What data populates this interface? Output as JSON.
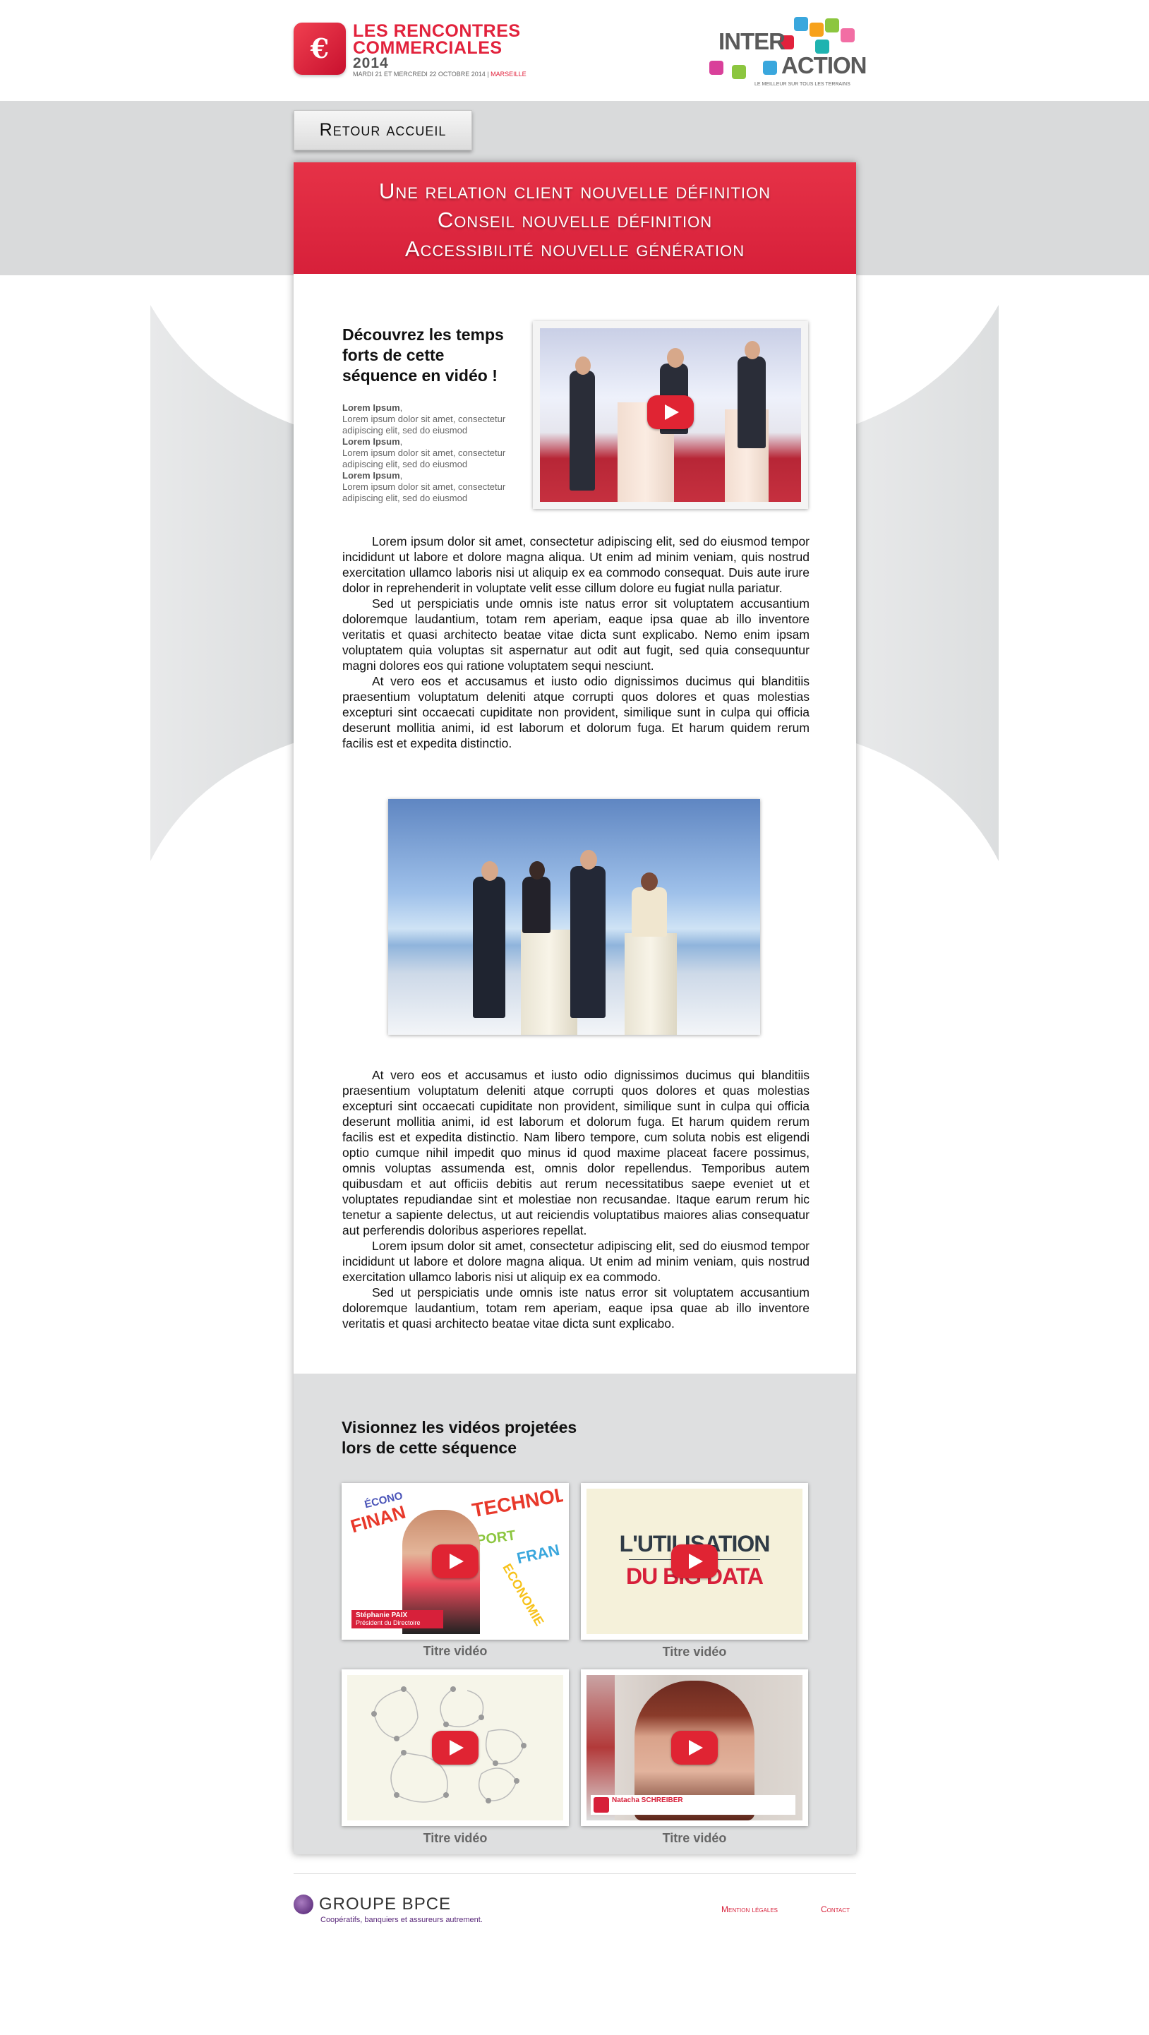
{
  "header": {
    "event_title_line1": "LES RENCONTRES",
    "event_title_line2": "COMMERCIALES",
    "event_year": "2014",
    "event_dates": "MARDI 21 ET MERCREDI 22 OCTOBRE 2014",
    "event_city": "MARSEILLE",
    "partner_word1": "INTER",
    "partner_word2": "ACTION",
    "partner_tagline": "LE MEILLEUR SUR TOUS LES TERRAINS"
  },
  "back_button": {
    "label": "Retour accueil"
  },
  "banner": {
    "line1": "Une relation client nouvelle définition",
    "line2": "Conseil nouvelle définition",
    "line3": "Accessibilité nouvelle génération"
  },
  "intro": {
    "title": "Découvrez les temps forts de cette séquence en vidéo !",
    "items": [
      {
        "head": "Lorem Ipsum",
        "text": "Lorem ipsum dolor sit amet, consectetur adipiscing elit, sed do eiusmod"
      },
      {
        "head": "Lorem Ipsum",
        "text": "Lorem ipsum dolor sit amet, consectetur adipiscing elit, sed do eiusmod"
      },
      {
        "head": "Lorem Ipsum",
        "text": "Lorem ipsum dolor sit amet, consectetur adipiscing elit, sed do eiusmod"
      }
    ]
  },
  "body_top": [
    "Lorem ipsum dolor sit amet, consectetur adipiscing elit, sed do eiusmod tempor incididunt ut labore et dolore magna aliqua. Ut enim ad minim veniam, quis nostrud exercitation ullamco laboris nisi ut aliquip ex ea commodo consequat. Duis aute irure dolor in reprehenderit in voluptate velit esse cillum dolore eu fugiat nulla pariatur.",
    "Sed ut perspiciatis unde omnis iste natus error sit voluptatem accusantium doloremque laudantium, totam rem aperiam, eaque ipsa quae ab illo inventore veritatis et quasi architecto beatae vitae dicta sunt explicabo. Nemo enim ipsam voluptatem quia voluptas sit aspernatur aut odit aut fugit, sed quia consequuntur magni dolores eos qui ratione voluptatem sequi nesciunt.",
    "At vero eos et accusamus et iusto odio dignissimos ducimus qui blanditiis praesentium voluptatum deleniti atque corrupti quos dolores et quas molestias excepturi sint occaecati cupiditate non provident, similique sunt in culpa qui officia deserunt mollitia animi, id est laborum et dolorum fuga. Et harum quidem rerum facilis est et expedita distinctio."
  ],
  "body_bottom": [
    "At vero eos et accusamus et iusto odio dignissimos ducimus qui blanditiis praesentium voluptatum deleniti atque corrupti quos dolores et quas molestias excepturi sint occaecati cupiditate non provident, similique sunt in culpa qui officia deserunt mollitia animi, id est laborum et dolorum fuga. Et harum quidem rerum facilis est et expedita distinctio. Nam libero tempore, cum soluta nobis est eligendi optio cumque nihil impedit quo minus id quod maxime placeat facere possimus, omnis voluptas assumenda est, omnis dolor repellendus. Temporibus autem quibusdam et aut officiis debitis aut rerum necessitatibus saepe eveniet ut et voluptates repudiandae sint et molestiae non recusandae. Itaque earum rerum hic tenetur a sapiente delectus, ut aut reiciendis voluptatibus maiores alias consequatur aut perferendis doloribus asperiores repellat.",
    "Lorem ipsum dolor sit amet, consectetur adipiscing elit, sed do eiusmod tempor incididunt ut labore et dolore magna aliqua. Ut enim ad minim veniam, quis nostrud exercitation ullamco laboris nisi ut aliquip ex ea commodo.",
    "Sed ut perspiciatis unde omnis iste natus error sit voluptatem accusantium doloremque laudantium, totam rem aperiam, eaque ipsa quae ab illo inventore veritatis et quasi architecto beatae vitae dicta sunt explicabo."
  ],
  "videos_section": {
    "title_line1": "Visionnez les vidéos projetées",
    "title_line2": "lors de cette séquence",
    "videos": [
      {
        "caption": "Titre vidéo",
        "person_name": "Stéphanie PAIX",
        "person_role": "Président du Directoire",
        "words": [
          "TECHNOLO",
          "FINAN",
          "ECONOMIE",
          "SPORT",
          "FRAN",
          "ÉCONO"
        ]
      },
      {
        "caption": "Titre vidéo",
        "slide_line1": "L'UTILISATION",
        "slide_line2": "DU BIG DATA"
      },
      {
        "caption": "Titre vidéo"
      },
      {
        "caption": "Titre vidéo",
        "person_name": "Natacha SCHREIBER"
      }
    ]
  },
  "footer": {
    "group_name": "GROUPE BPCE",
    "slogan": "Coopératifs, banquiers et assureurs autrement.",
    "legal_link": "Mention légales",
    "contact_link": "Contact"
  },
  "colors": {
    "brand_red": "#d7203a",
    "band_grey": "#d9dadb",
    "lower_grey": "#dedfe0",
    "bpce_purple": "#5a2a7a"
  },
  "icons": [
    "play-icon",
    "caisse-epargne-squirrel-icon",
    "bpce-logo-icon"
  ]
}
